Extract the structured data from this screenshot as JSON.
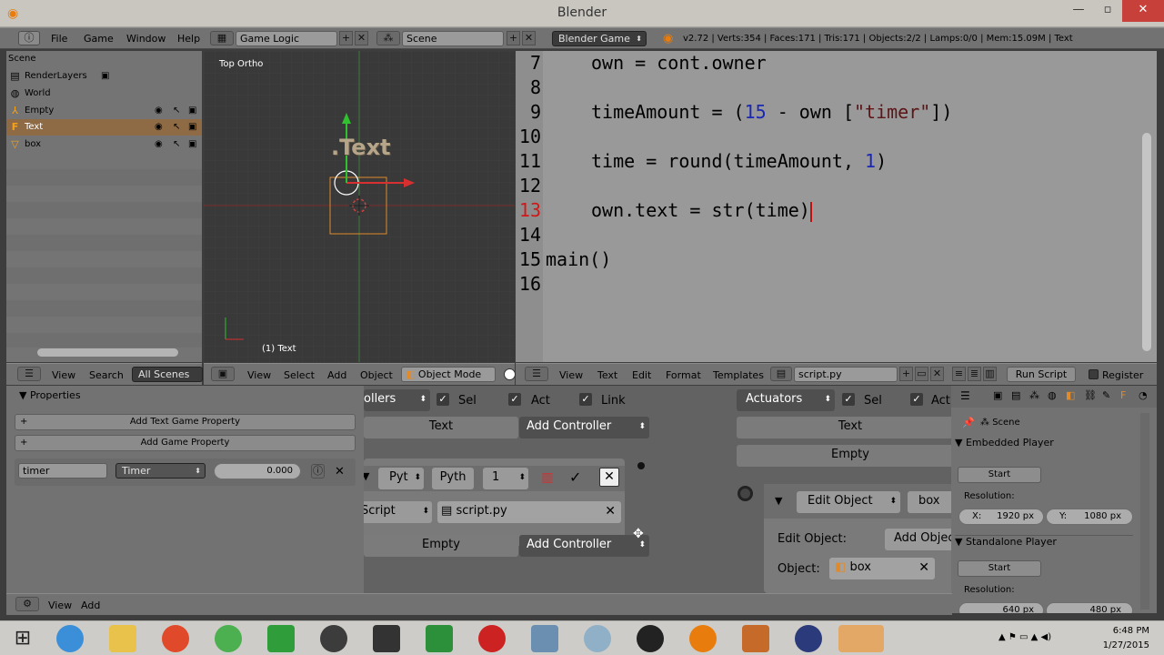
{
  "window": {
    "title": "Blender"
  },
  "info": {
    "menus": [
      "File",
      "Game",
      "Window",
      "Help"
    ],
    "layout": "Game Logic",
    "scene": "Scene",
    "engine": "Blender Game",
    "stats": "v2.72 | Verts:354 | Faces:171 | Tris:171 | Objects:2/2 | Lamps:0/0 | Mem:15.09M | Text"
  },
  "outliner": {
    "items": [
      {
        "label": "Scene"
      },
      {
        "label": "RenderLayers"
      },
      {
        "label": "World"
      },
      {
        "label": "Empty"
      },
      {
        "label": "Text"
      },
      {
        "label": "box"
      }
    ]
  },
  "viewport": {
    "label": "Top Ortho",
    "object": "(1) Text",
    "text_obj": ".Text"
  },
  "code": {
    "lines": [
      {
        "n": "7",
        "text": "own = cont.owner"
      },
      {
        "n": "8",
        "text": ""
      },
      {
        "n": "9",
        "pre": "timeAmount = (",
        "num": "15",
        "mid": " - own [",
        "str": "\"timer\"",
        "post": "])"
      },
      {
        "n": "10",
        "text": ""
      },
      {
        "n": "11",
        "pre2": "time = round(timeAmount, ",
        "num2": "1",
        "post2": ")"
      },
      {
        "n": "12",
        "text": ""
      },
      {
        "n": "13",
        "text": "own.text = str(time)"
      },
      {
        "n": "14",
        "text": ""
      },
      {
        "n": "15",
        "text": "main()"
      },
      {
        "n": "16",
        "text": ""
      }
    ]
  },
  "headers": {
    "outliner": {
      "view": "View",
      "search": "Search",
      "filter": "All Scenes"
    },
    "viewport": {
      "view": "View",
      "select": "Select",
      "add": "Add",
      "object": "Object",
      "mode": "Object Mode"
    },
    "text": {
      "view": "View",
      "text": "Text",
      "edit": "Edit",
      "format": "Format",
      "templates": "Templates",
      "file": "script.py",
      "run": "Run Script",
      "register": "Register"
    },
    "bottom": {
      "view": "View",
      "add": "Add"
    }
  },
  "properties": {
    "title": "Properties",
    "add_text_prop": "Add Text Game Property",
    "add_prop": "Add Game Property",
    "prop_name": "timer",
    "prop_type": "Timer",
    "prop_value": "0.000"
  },
  "logic": {
    "controllers_label": "ollers",
    "sel": "Sel",
    "act": "Act",
    "link": "Link",
    "text_obj": "Text",
    "add_controller": "Add Controller",
    "pyt": "Pyt",
    "pyth": "Pyth",
    "one": "1",
    "script": "Script",
    "script_file": "script.py",
    "empty_obj": "Empty",
    "actuators": "Actuators",
    "act_sel": "Sel",
    "act_act": "Act",
    "act_text": "Text",
    "act_empty": "Empty",
    "edit_object": "Edit Object",
    "box": "box",
    "edit_object_label": "Edit Object:",
    "add_object": "Add Object",
    "object_label": "Object:",
    "object_value": "box"
  },
  "rprops": {
    "scene": "Scene",
    "embedded": "Embedded Player",
    "start": "Start",
    "resolution": "Resolution:",
    "x_label": "X:",
    "x_value": "1920 px",
    "y_label": "Y:",
    "y_value": "1080 px",
    "standalone": "Standalone Player",
    "start2": "Start",
    "resolution2": "Resolution:",
    "x2_value": "640 px",
    "y2_value": "480 px"
  },
  "taskbar": {
    "time": "6:48 PM",
    "date": "1/27/2015"
  }
}
